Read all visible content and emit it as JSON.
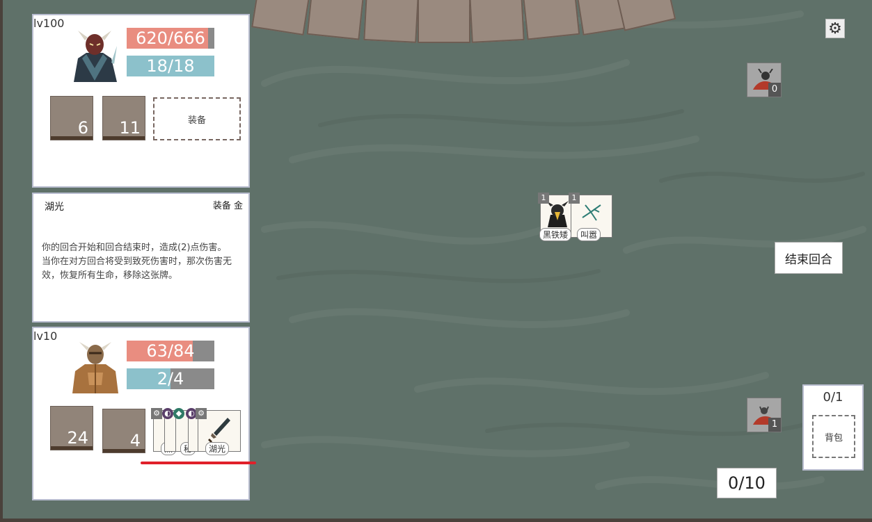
{
  "enemy": {
    "level": "lv100",
    "hp_text": "620/666",
    "hp_ratio": 0.93,
    "mp_text": "18/18",
    "mp_ratio": 1.0,
    "slots": [
      "6",
      "11"
    ],
    "equip_label": "装备"
  },
  "card_detail": {
    "title": "湖光",
    "type": "装备 金",
    "desc_line1": "你的回合开始和回合结束时，造成(2)点伤害。",
    "desc_line2": "当你在对方回合将受到致死伤害时，那次伤害无效，恢复所有生命，移除这张牌。"
  },
  "player": {
    "level": "lv10",
    "hp_text": "63/84",
    "hp_ratio": 0.75,
    "mp_text": "2/4",
    "mp_ratio": 0.5,
    "slots": [
      "24",
      "4"
    ],
    "equip_card_label": "湖光",
    "stack_labels": [
      "黑",
      "秘"
    ]
  },
  "field": {
    "cards": [
      {
        "cost": "1",
        "label": "黑铁矮"
      },
      {
        "cost": "1",
        "label": "叫嚣"
      }
    ]
  },
  "decks": {
    "enemy_count": "0",
    "player_count": "1"
  },
  "controls": {
    "end_turn": "结束回合",
    "energy": "0/10",
    "settings_icon": "gear-icon"
  },
  "bag": {
    "count": "0/1",
    "label": "背包"
  }
}
